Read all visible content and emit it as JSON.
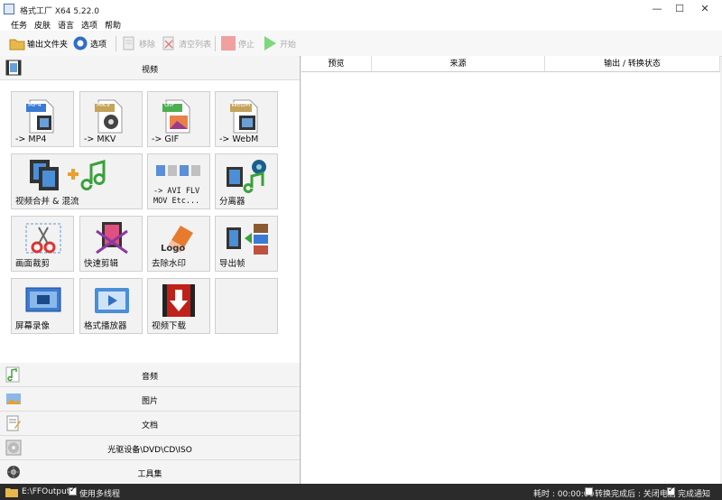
{
  "window": {
    "title": "格式工厂 X64 5.22.0",
    "minimize": "—",
    "maximize": "☐",
    "close": "✕"
  },
  "menu": [
    "任务",
    "皮肤",
    "语言",
    "选项",
    "帮助"
  ],
  "toolbar": {
    "output_folder": "输出文件夹",
    "options": "选项",
    "remove": "移除",
    "clear_list": "清空列表",
    "stop": "停止",
    "start": "开始"
  },
  "categories": {
    "video": "视频",
    "audio": "音频",
    "picture": "图片",
    "document": "文档",
    "disc": "光驱设备\\DVD\\CD\\ISO",
    "toolbox": "工具集"
  },
  "tiles": {
    "mp4": {
      "caption": "-> MP4",
      "badge": "MP4"
    },
    "mkv": {
      "caption": "-> MKV",
      "badge": "MKV"
    },
    "gif": {
      "caption": "-> GIF",
      "badge": "GIF"
    },
    "webm": {
      "caption": "-> WebM",
      "badge": "WebM"
    },
    "merge": {
      "caption": "视频合并 & 混流"
    },
    "avi": {
      "line1": "-> AVI FLV",
      "line2": "MOV Etc..."
    },
    "splitter": {
      "caption": "分离器"
    },
    "crop": {
      "caption": "画面裁剪"
    },
    "fastclip": {
      "caption": "快速剪辑"
    },
    "watermark": {
      "caption": "去除水印",
      "logo_text": "Logo"
    },
    "frames": {
      "caption": "导出帧"
    },
    "record": {
      "caption": "屏幕录像"
    },
    "player": {
      "caption": "格式播放器"
    },
    "download": {
      "caption": "视频下载"
    }
  },
  "table": {
    "columns": [
      "预览",
      "来源",
      "输出 / 转换状态"
    ]
  },
  "status": {
    "output_path": "E:\\FFOutput",
    "multithread": "使用多线程",
    "elapsed": "耗时 : 00:00:00",
    "after_convert": "转换完成后 : 关闭电脑",
    "notify": "完成通知"
  },
  "colors": {
    "mp4_badge": "#3a7bd5",
    "mkv_badge": "#c4a35a",
    "gif_badge": "#4caf50",
    "webm_badge": "#c4a35a",
    "stop_icon": "#f0a0a0",
    "start_icon": "#7dd87d",
    "status_bg": "#2b2b2b"
  }
}
